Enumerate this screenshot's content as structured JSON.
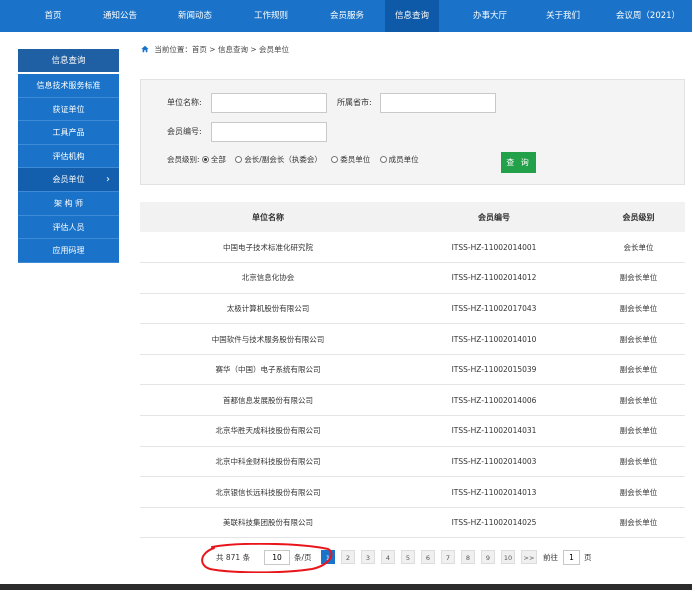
{
  "nav": {
    "items": [
      "首页",
      "通知公告",
      "新闻动态",
      "工作规则",
      "会员服务",
      "信息查询",
      "办事大厅",
      "关于我们",
      "会议周（2021）"
    ],
    "active_index": 5
  },
  "sidebar": {
    "title": "信息查询",
    "items": [
      "信息技术服务标准",
      "获证单位",
      "工具产品",
      "评估机构",
      "会员单位",
      "架 构 师",
      "评估人员",
      "应用码理"
    ],
    "active_index": 4,
    "chevron": "›"
  },
  "breadcrumb": {
    "icon": "home-icon",
    "text": "当前位置：首页 > 信息查询 > 会员单位"
  },
  "filter": {
    "unit_name_label": "单位名称:",
    "unit_name_value": "",
    "province_label": "所属省市:",
    "province_value": "",
    "member_no_label": "会员编号:",
    "member_no_value": "",
    "level_label": "会员级别:",
    "levels": [
      "全部",
      "会长/副会长（执委会）",
      "委员单位",
      "成员单位"
    ],
    "selected_level_index": 0,
    "search_button": "查 询"
  },
  "table": {
    "headers": [
      "单位名称",
      "会员编号",
      "会员级别"
    ],
    "rows": [
      [
        "中国电子技术标准化研究院",
        "ITSS-HZ-11002014001",
        "会长单位"
      ],
      [
        "北京信息化协会",
        "ITSS-HZ-11002014012",
        "副会长单位"
      ],
      [
        "太极计算机股份有限公司",
        "ITSS-HZ-11002017043",
        "副会长单位"
      ],
      [
        "中国软件与技术服务股份有限公司",
        "ITSS-HZ-11002014010",
        "副会长单位"
      ],
      [
        "赛华（中国）电子系统有限公司",
        "ITSS-HZ-11002015039",
        "副会长单位"
      ],
      [
        "首都信息发展股份有限公司",
        "ITSS-HZ-11002014006",
        "副会长单位"
      ],
      [
        "北京华胜天成科技股份有限公司",
        "ITSS-HZ-11002014031",
        "副会长单位"
      ],
      [
        "北京中科金财科技股份有限公司",
        "ITSS-HZ-11002014003",
        "副会长单位"
      ],
      [
        "北京银信长远科技股份有限公司",
        "ITSS-HZ-11002014013",
        "副会长单位"
      ],
      [
        "美联科技集团股份有限公司",
        "ITSS-HZ-11002014025",
        "副会长单位"
      ]
    ]
  },
  "pagination": {
    "total_text": "共 871 条",
    "page_size": "10",
    "per_page_text": "条/页",
    "pages": [
      "1",
      "2",
      "3",
      "4",
      "5",
      "6",
      "7",
      "8",
      "9",
      "10",
      ">>"
    ],
    "active_page": "1",
    "goto_label": "前往",
    "goto_value": "1",
    "page_suffix": "页"
  },
  "colors": {
    "nav_bg": "#1a73c9",
    "nav_active": "#0f5aa8",
    "search_button": "#22a04a",
    "annotation": "#e8161b"
  }
}
